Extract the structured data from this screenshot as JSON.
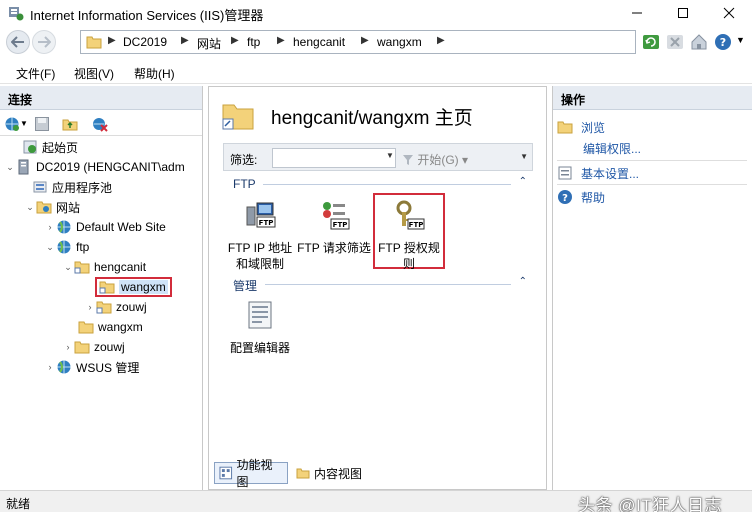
{
  "window": {
    "title": "Internet Information Services (IIS)管理器"
  },
  "address": {
    "crumbs": [
      "DC2019",
      "网站",
      "ftp",
      "hengcanit",
      "wangxm"
    ]
  },
  "menu": {
    "items": [
      "文件(F)",
      "视图(V)",
      "帮助(H)"
    ]
  },
  "connections": {
    "header": "连接",
    "tree": {
      "start_page": "起始页",
      "server": "DC2019 (HENGCANIT\\adm",
      "app_pools": "应用程序池",
      "sites": "网站",
      "default_site": "Default Web Site",
      "ftp": "ftp",
      "hengcanit": "hengcanit",
      "wangxm_selected": "wangxm",
      "zouwj_sub": "zouwj",
      "wangxm": "wangxm",
      "zouwj": "zouwj",
      "wsus": "WSUS 管理"
    }
  },
  "center": {
    "title": "hengcanit/wangxm 主页",
    "filter_label": "筛选:",
    "filter_go": "开始(G)",
    "group_ftp": "FTP",
    "group_manage": "管理",
    "features": {
      "ip_restrict": "FTP IP 地址和域限制",
      "request_filter": "FTP 请求筛选",
      "auth_rules": "FTP 授权规则",
      "config_editor": "配置编辑器"
    },
    "ftp_badge": "FTP",
    "tab_features": "功能视图",
    "tab_content": "内容视图"
  },
  "actions": {
    "header": "操作",
    "browse": "浏览",
    "edit_permissions": "编辑权限...",
    "basic_settings": "基本设置...",
    "help": "帮助"
  },
  "status": {
    "text": "就绪",
    "watermark": "头条 @IT狂人日志"
  },
  "colors": {
    "accent_link": "#1f57a6",
    "selection_border": "#d22c3b",
    "pane_header": "#e6ebf2"
  }
}
